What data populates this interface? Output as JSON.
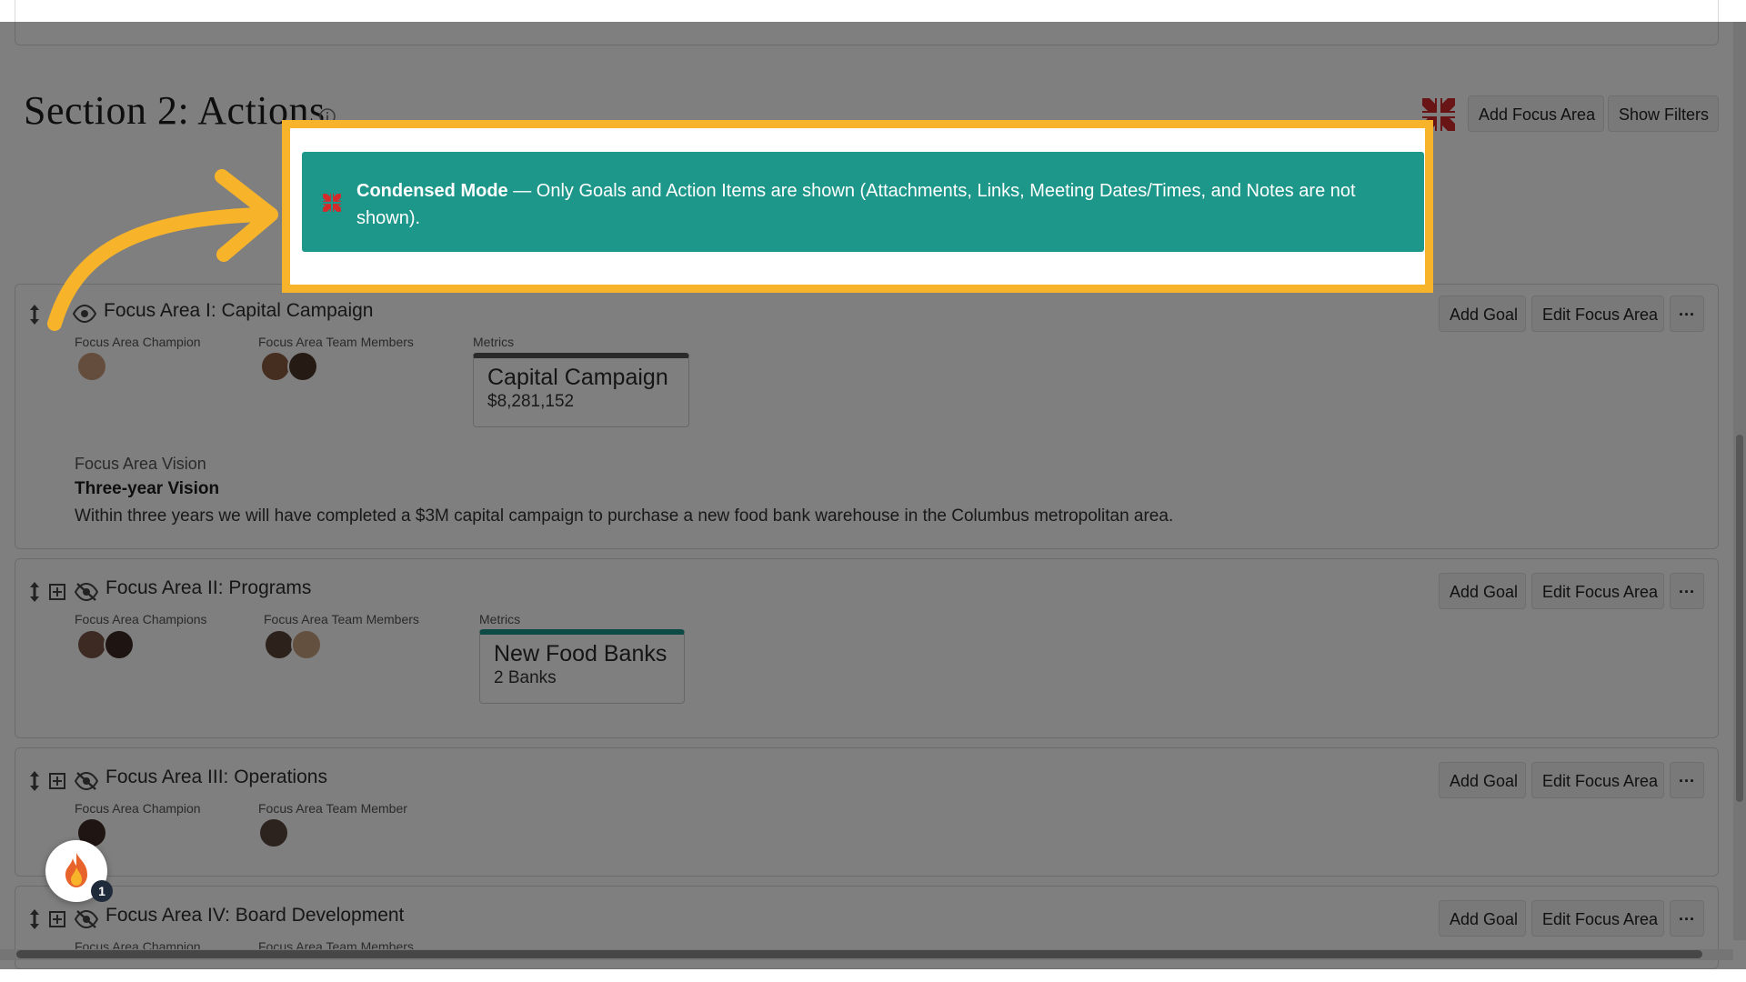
{
  "section": {
    "title": "Section 2: Actions",
    "add_focus_area_label": "Add Focus Area",
    "show_filters_label": "Show Filters"
  },
  "banner": {
    "strong": "Condensed Mode",
    "text_line1": " — Only Goals and Action Items are shown (Attachments, Links, Meeting Dates/Times, and Notes are not",
    "text_line2": "shown)."
  },
  "focus_areas": [
    {
      "title": "Focus Area I: Capital Campaign",
      "champion_label": "Focus Area Champion",
      "team_label": "Focus Area Team Members",
      "metrics_label": "Metrics",
      "metric_title": "Capital Campaign",
      "metric_value": "$8,281,152",
      "vision_label": "Focus Area Vision",
      "vision_heading": "Three-year Vision",
      "vision_text": "Within three years we will have completed a $3M capital campaign to purchase a new food bank warehouse in the Columbus metropolitan area."
    },
    {
      "title": "Focus Area II: Programs",
      "champion_label": "Focus Area Champions",
      "team_label": "Focus Area Team Members",
      "metrics_label": "Metrics",
      "metric_title": "New Food Banks",
      "metric_value": "2 Banks"
    },
    {
      "title": "Focus Area III: Operations",
      "champion_label": "Focus Area Champion",
      "team_label": "Focus Area Team Member"
    },
    {
      "title": "Focus Area IV: Board Development",
      "champion_label": "Focus Area Champion",
      "team_label": "Focus Area Team Members"
    }
  ],
  "buttons": {
    "add_goal": "Add Goal",
    "edit_focus_area": "Edit Focus Area",
    "more": "···"
  },
  "notification": {
    "count": "1"
  },
  "colors": {
    "highlight": "#f7b42b",
    "banner": "#1e978b",
    "metric_bar_1": "#555555",
    "metric_bar_2": "#1e978b",
    "condensed_icon": "#d42a2a"
  }
}
